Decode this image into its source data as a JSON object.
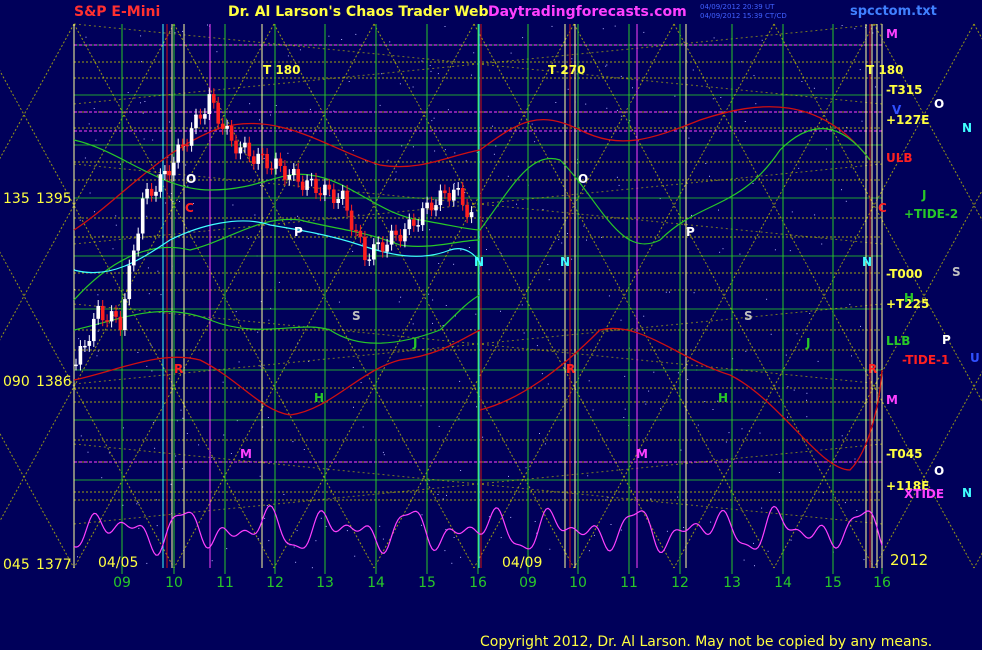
{
  "header": {
    "instrument": "S&P E-Mini",
    "title": "Dr. Al Larson's Chaos Trader Web",
    "site": "Daytradingforecasts.com",
    "stamp_line1": "04/09/2012 20:39 UT",
    "stamp_line2": "04/09/2012 15:39 CT/CD",
    "file": "spcctom.txt"
  },
  "footer": {
    "copyright": "Copyright 2012, Dr. Al Larson. May not be copied by any means."
  },
  "colors": {
    "background": "#00005a",
    "grid_yellow": "#c8c800",
    "grid_green": "#28c828",
    "magenta": "#ff40ff",
    "red": "#d01010",
    "white": "#ffffff",
    "cyan": "#40ffff",
    "text_yellow": "#ffff40"
  },
  "chart_data": {
    "type": "line",
    "title": "S&P E-Mini",
    "y_axis": {
      "ticks": [
        {
          "angle": "135",
          "price": "1395"
        },
        {
          "angle": "090",
          "price": "1386"
        },
        {
          "angle": "045",
          "price": "1377"
        }
      ],
      "ylim": [
        1377,
        1400
      ]
    },
    "x_axis": {
      "ticks": [
        "09",
        "10",
        "11",
        "12",
        "13",
        "14",
        "15",
        "16",
        "09",
        "10",
        "11",
        "12",
        "13",
        "14",
        "15",
        "16"
      ],
      "dates": [
        "04/05",
        "04/09"
      ],
      "year": "2012"
    },
    "series": [
      {
        "name": "Price (04/05)",
        "x": [
          "09:00",
          "09:30",
          "10:00",
          "10:15",
          "10:30",
          "10:45",
          "11:00",
          "11:15",
          "11:30",
          "12:00",
          "12:30",
          "13:00",
          "13:30",
          "13:45",
          "14:00",
          "14:30",
          "15:00",
          "15:30",
          "16:00"
        ],
        "values": [
          1385.6,
          1387.8,
          1387.4,
          1392.5,
          1393.6,
          1395.2,
          1396.8,
          1395.0,
          1394.4,
          1394.0,
          1393.4,
          1393.0,
          1392.6,
          1390.2,
          1390.8,
          1391.4,
          1392.4,
          1393.0,
          1391.6
        ]
      }
    ],
    "level_labels": [
      {
        "text": "T  180",
        "where": "top"
      },
      {
        "text": "T  270",
        "where": "top"
      },
      {
        "text": "T  180",
        "where": "top"
      },
      {
        "text": "-T315",
        "where": "right"
      },
      {
        "text": "+127E",
        "where": "right"
      },
      {
        "text": "ULB",
        "where": "right"
      },
      {
        "text": "+TIDE-2",
        "where": "right"
      },
      {
        "text": "-T000",
        "where": "right"
      },
      {
        "text": "+T225",
        "where": "right"
      },
      {
        "text": "LLB",
        "where": "right"
      },
      {
        "text": "-TIDE-1",
        "where": "right"
      },
      {
        "text": "-T045",
        "where": "right"
      },
      {
        "text": "+118E",
        "where": "right"
      },
      {
        "text": "XTIDE",
        "where": "right"
      }
    ],
    "point_labels": [
      "O",
      "C",
      "N",
      "P",
      "S",
      "J",
      "R",
      "H",
      "M",
      "U",
      "V"
    ],
    "grid": true,
    "legend": "none"
  }
}
